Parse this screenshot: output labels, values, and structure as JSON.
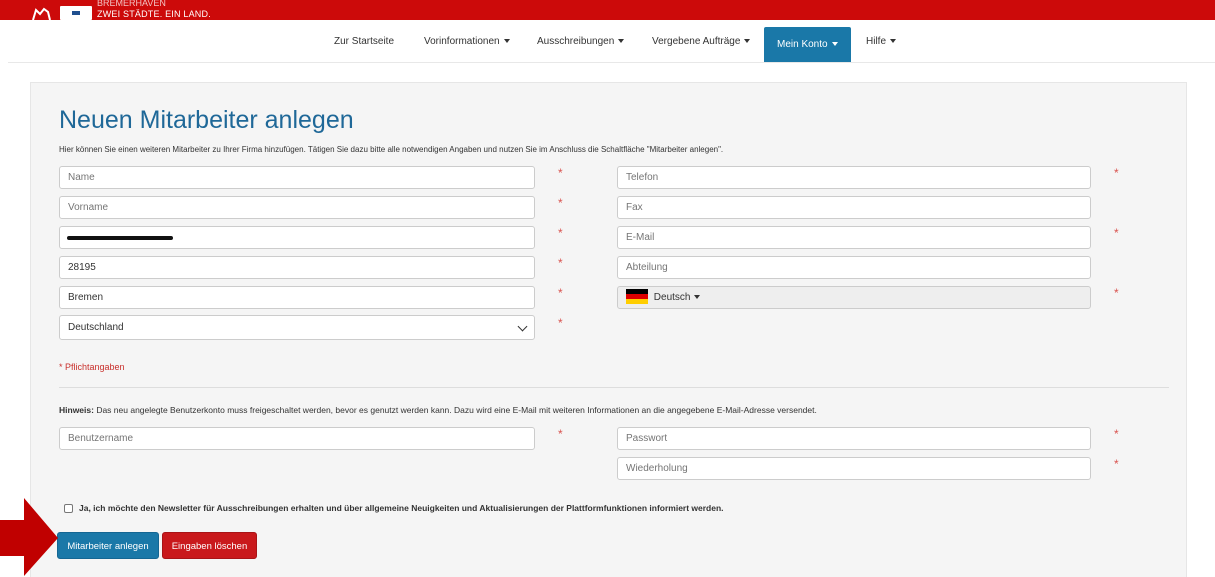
{
  "header": {
    "slogan_top": "BREMERHAVEN",
    "slogan": "ZWEI STÄDTE. EIN LAND."
  },
  "nav": {
    "items": [
      {
        "label": "Zur Startseite",
        "dropdown": false
      },
      {
        "label": "Vorinformationen",
        "dropdown": true
      },
      {
        "label": "Ausschreibungen",
        "dropdown": true
      },
      {
        "label": "Vergebene Aufträge",
        "dropdown": true
      },
      {
        "label": "Mein Konto",
        "dropdown": true,
        "active": true
      },
      {
        "label": "Hilfe",
        "dropdown": true
      }
    ]
  },
  "page": {
    "title": "Neuen Mitarbeiter anlegen",
    "intro": "Hier können Sie einen weiteren Mitarbeiter zu Ihrer Firma hinzufügen. Tätigen Sie dazu bitte alle notwendigen Angaben und nutzen Sie im Anschluss die Schaltfläche \"Mitarbeiter anlegen\"."
  },
  "form": {
    "required_mark": "*",
    "name": {
      "placeholder": "Name",
      "value": ""
    },
    "vorname": {
      "placeholder": "Vorname",
      "value": ""
    },
    "street": {
      "value": "",
      "redacted": true
    },
    "plz": {
      "value": "28195"
    },
    "ort": {
      "value": "Bremen"
    },
    "land": {
      "selected": "Deutschland"
    },
    "telefon": {
      "placeholder": "Telefon",
      "value": ""
    },
    "fax": {
      "placeholder": "Fax",
      "value": ""
    },
    "email": {
      "placeholder": "E-Mail",
      "value": ""
    },
    "abteilung": {
      "placeholder": "Abteilung",
      "value": ""
    },
    "language": {
      "label": "Deutsch",
      "flag_colors": [
        "#000000",
        "#dd0000",
        "#ffce00"
      ]
    },
    "pflicht_note": "* Pflichtangaben",
    "hint_bold": "Hinweis:",
    "hint_text": " Das neu angelegte Benutzerkonto muss freigeschaltet werden, bevor es genutzt werden kann. Dazu wird eine E-Mail mit weiteren Informationen an die angegebene E-Mail-Adresse versendet.",
    "benutzername": {
      "placeholder": "Benutzername",
      "value": ""
    },
    "passwort": {
      "placeholder": "Passwort",
      "value": ""
    },
    "wiederholung": {
      "placeholder": "Wiederholung",
      "value": ""
    },
    "newsletter": {
      "checked": false,
      "label": "Ja, ich möchte den Newsletter für Ausschreibungen erhalten und über allgemeine Neuigkeiten und Aktualisierungen der Plattformfunktionen informiert werden."
    }
  },
  "buttons": {
    "submit": "Mitarbeiter anlegen",
    "reset": "Eingaben löschen"
  },
  "colors": {
    "brand_red": "#cc0a0a",
    "primary": "#1a78a8",
    "danger": "#c9191c",
    "title": "#1f6898",
    "required": "#d9534f",
    "arrow": "#c00000"
  }
}
